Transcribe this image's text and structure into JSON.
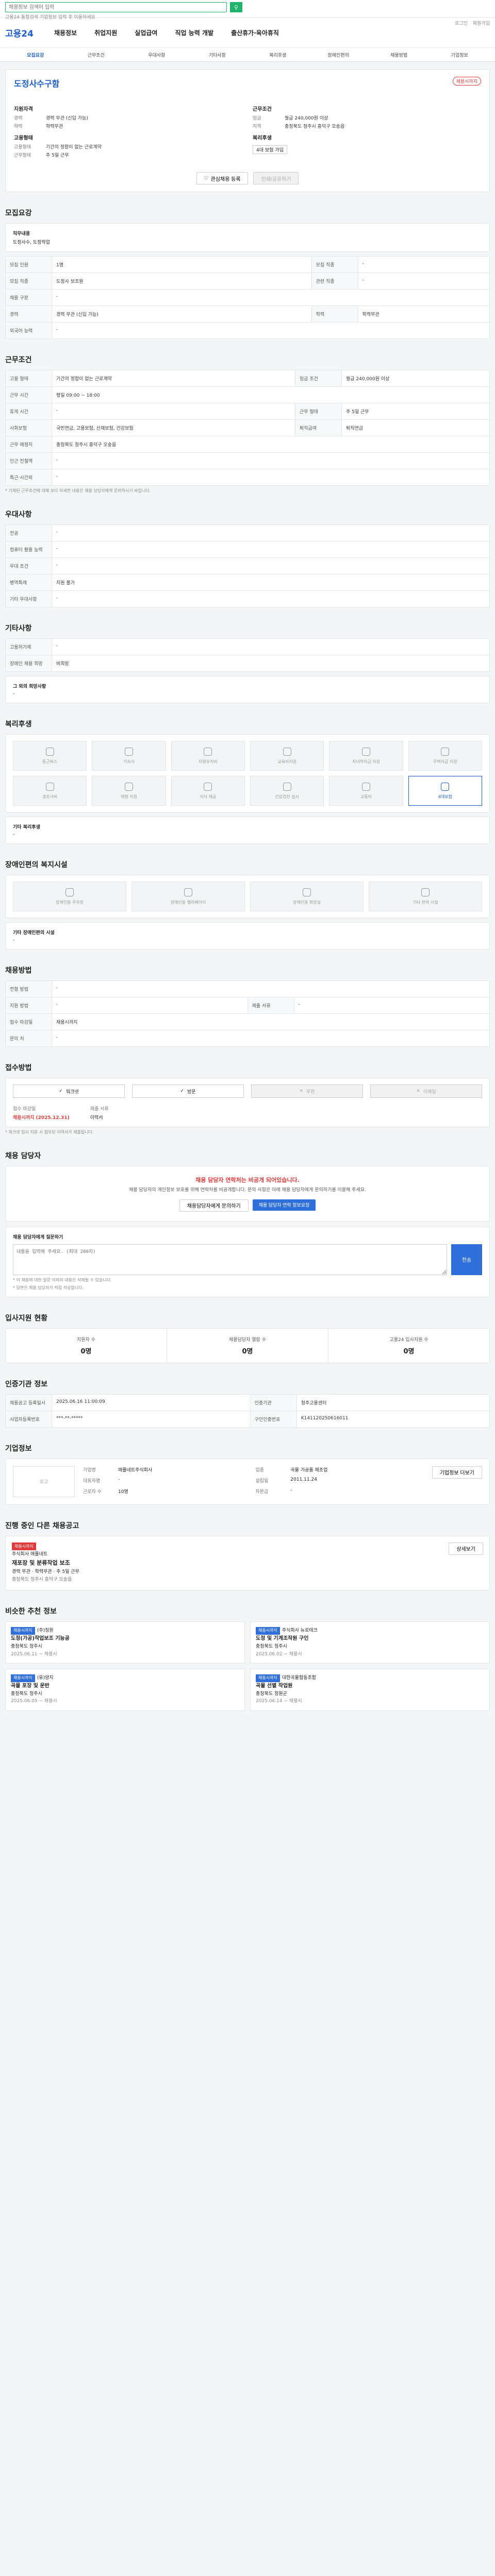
{
  "top": {
    "search_placeholder": "채용정보 검색어 입력",
    "tiny": "고용24 통합검색 기업정보 입력 후 이용하세요"
  },
  "header": {
    "logo": "고용24",
    "nav": [
      "채용정보",
      "취업지원",
      "실업급여",
      "직업 능력 개발",
      "출산휴가·육아휴직"
    ],
    "util": [
      "로그인",
      "회원가입"
    ],
    "subtabs": [
      "모집요강",
      "근무조건",
      "우대사항",
      "기타사항",
      "복리후생",
      "장애인편의",
      "채용방법",
      "기업정보"
    ]
  },
  "company": {
    "name": "도정사수구함",
    "badge": "채용시까지",
    "apply_title": "지원자격",
    "apply": [
      {
        "k": "경력",
        "v": "경력 무관 (신입 가능)"
      },
      {
        "k": "학력",
        "v": "학력무관"
      }
    ],
    "cond_title": "근무조건",
    "cond": [
      {
        "k": "임금",
        "v": "월급 240,000원 이상"
      },
      {
        "k": "지역",
        "v": "충청북도 청주시 흥덕구 오송읍"
      }
    ],
    "form_title": "고용형태",
    "form": [
      {
        "k": "고용형태",
        "v": "기간의 정함이 없는 근로계약"
      },
      {
        "k": "근무형태",
        "v": "주 5일 근무"
      }
    ],
    "welfare_title": "복리후생",
    "welfare_chip": "4대 보험 가입",
    "scrap": "관심채용 등록",
    "share": "인쇄/공유하기"
  },
  "recruit": {
    "title": "모집요강",
    "job_label": "직무내용",
    "job_value": "도정사수, 도정작업",
    "rows": [
      {
        "k1": "모집 인원",
        "v1": "1명",
        "k2": "모집 직종",
        "v2": "-"
      },
      {
        "k1": "모집 직종",
        "v1": "도정사 보조원",
        "k2": "관련 직종",
        "v2": "-"
      },
      {
        "k1": "채용 구분",
        "v1": "-",
        "k2": "",
        "v2": ""
      },
      {
        "k1": "경력",
        "v1": "경력 무관 (신입 가능)",
        "k2": "학력",
        "v2": "학력무관"
      },
      {
        "k1": "외국어 능력",
        "v1": "-",
        "k2": "",
        "v2": ""
      }
    ]
  },
  "work": {
    "title": "근무조건",
    "rows": [
      {
        "k1": "고용 형태",
        "v1": "기간의 정함이 없는 근로계약",
        "k2": "임금 조건",
        "v2": "월급 240,000원 이상"
      },
      {
        "k1": "근무 시간",
        "v1": "평일 09:00 ~ 18:00",
        "k2": "",
        "v2": ""
      },
      {
        "k1": "휴게 시간",
        "v1": "-",
        "k2": "근무 형태",
        "v2": "주 5일 근무"
      },
      {
        "k1": "사회보험",
        "v1": "국민연금, 고용보험, 산재보험, 건강보험",
        "k2": "퇴직급여",
        "v2": "퇴직연금"
      },
      {
        "k1": "근무 예정지",
        "v1": "충청북도 청주시 흥덕구 오송읍",
        "k2": "",
        "v2": ""
      },
      {
        "k1": "인근 전철역",
        "v1": "-",
        "k2": "",
        "v2": ""
      },
      {
        "k1": "특근·시간외",
        "v1": "-",
        "k2": "",
        "v2": ""
      }
    ],
    "note": "* 기재된 근무조건에 대해 보다 자세한 내용은 채용 담당자에게 문의하시기 바랍니다."
  },
  "pref": {
    "title": "우대사항",
    "rows": [
      {
        "k": "전공",
        "v": "-"
      },
      {
        "k": "컴퓨터 활용 능력",
        "v": "-"
      },
      {
        "k": "우대 조건",
        "v": "-"
      },
      {
        "k": "병역특례",
        "v": "지원 불가"
      },
      {
        "k": "기타 우대사항",
        "v": "-"
      }
    ]
  },
  "etc": {
    "title": "기타사항",
    "rows": [
      {
        "k": "고용허가제",
        "v": "-"
      },
      {
        "k": "장애인 채용 희망",
        "v": "비희망"
      }
    ],
    "extra_label": "그 외의 희망사항",
    "extra_value": "-"
  },
  "welfare": {
    "title": "복리후생",
    "items": [
      "통근버스",
      "기숙사",
      "차량유지비",
      "교육비지원",
      "자녀학자금 지원",
      "주택자금 지원",
      "경조사비",
      "재형 지원",
      "식사 제공",
      "건강검진 실시",
      "교통비",
      "4대보험"
    ],
    "on_index": 11,
    "extra_label": "기타 복리후생",
    "extra_value": "-"
  },
  "facility": {
    "title": "장애인편의 복지시설",
    "items": [
      "장애인용 주차장",
      "장애인용 엘리베이터",
      "장애인용 화장실",
      "기타 편의 시설"
    ],
    "extra_label": "기타 장애인편의 시설",
    "extra_value": "-"
  },
  "recruit_method": {
    "title": "채용방법",
    "rows": [
      {
        "k1": "전형 방법",
        "v1": "-",
        "k2": "",
        "v2": ""
      },
      {
        "k1": "지원 방법",
        "v1": "-",
        "k2": "제출 서류",
        "v2": "-"
      },
      {
        "k1": "접수 마감일",
        "v1": "채용시까지",
        "k2": "",
        "v2": ""
      },
      {
        "k1": "문의 처",
        "v1": "-",
        "k2": "",
        "v2": ""
      }
    ]
  },
  "apply_method": {
    "title": "접수방법",
    "items": [
      "워크넷",
      "방문",
      "우편",
      "이메일"
    ],
    "deadline_label": "접수 마감일",
    "deadline_value": "채용시까지 (2025.12.31)",
    "docs_label": "제출 서류",
    "docs_value": "이력서",
    "note": "* 워크넷 입사 지원 시 첨부된 이력서가 제출됩니다."
  },
  "contact": {
    "title": "채용 담당자",
    "alert": "채용 담당자 연락처는 비공개 되어있습니다.",
    "alert_body": "채용 담당자의 개인정보 보호를 위해 연락처를 비공개합니다. 문의 사항은 아래 채용 담당자에게 문의하기를 이용해 주세요.",
    "btn1": "채용담당자에게 문의하기",
    "btn2": "채용 담당자 연락 정보요청",
    "q_label": "채용 담당자에게 질문하기",
    "q_placeholder": "내용을 입력해 주세요. (최대 200자)",
    "q_send": "전송",
    "q_notes": [
      "* 이 채용에 대한 질문 이외의 내용은 삭제될 수 있습니다.",
      "* 답변은 채용 담당자가 직접 작성합니다."
    ]
  },
  "stats": {
    "title": "입사지원 현황",
    "items": [
      {
        "lbl": "지원자 수",
        "num": "0명"
      },
      {
        "lbl": "채용담당자 열람 수",
        "num": "0명"
      },
      {
        "lbl": "고용24 입사지원 수",
        "num": "0명"
      }
    ]
  },
  "info": {
    "title": "인증기관 정보",
    "rows": [
      {
        "k1": "채용공고 등록일시",
        "v1": "2025.06.16 11:00:09",
        "k2": "인증기관",
        "v2": "청주고용센터"
      },
      {
        "k1": "사업자등록번호",
        "v1": "***-**-*****",
        "k2": "구인인증번호",
        "v2": "K141120250616011"
      }
    ]
  },
  "biz": {
    "title": "기업정보",
    "logo": "로고",
    "fields": [
      {
        "k": "기업명",
        "v": "애플네트주식회사"
      },
      {
        "k": "업종",
        "v": "곡물 가공품 제조업"
      },
      {
        "k": "대표자명",
        "v": "-"
      },
      {
        "k": "설립일",
        "v": "2011.11.24"
      },
      {
        "k": "근로자 수",
        "v": "10명"
      },
      {
        "k": "자본금",
        "v": "-"
      }
    ],
    "btn": "기업정보 더보기"
  },
  "related": {
    "title": "진행 중인 다른 채용공고",
    "tags": [
      "채용시까지"
    ],
    "name": "주식회사 애플네트",
    "job": "재포장 및 분류작업 보조",
    "info": "경력 무관 · 학력무관 · 주 5일 근무",
    "area": "충청북도 청주시 흥덕구 오송읍",
    "btn": "상세보기"
  },
  "rec": {
    "title": "비슷한 추천 정보",
    "items": [
      {
        "tag": "채용시까지",
        "org": "(주)청원",
        "title": "도정(가공)작업보조 기능공",
        "area": "충청북도 청주시",
        "date": "2025.06.11 ~ 채용시"
      },
      {
        "tag": "채용시까지",
        "org": "주식회사 뉴로테크",
        "title": "도정 및 기계조작원 구인",
        "area": "충청북도 청주시",
        "date": "2025.06.02 ~ 채용시"
      },
      {
        "tag": "채용시까지",
        "org": "(유)양지",
        "title": "곡물 포장 및 운반",
        "area": "충청북도 청주시",
        "date": "2025.06.05 ~ 채용시"
      },
      {
        "tag": "채용시까지",
        "org": "대한곡물협동조합",
        "title": "곡물 선별 작업원",
        "area": "충청북도 청원군",
        "date": "2025.06.14 ~ 채용시"
      }
    ]
  }
}
